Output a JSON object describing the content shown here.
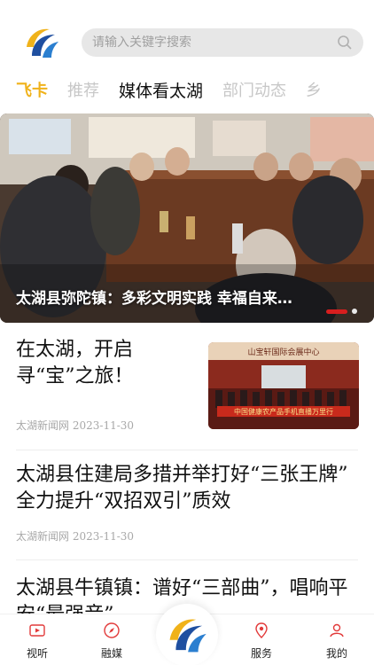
{
  "search": {
    "placeholder": "请输入关键字搜索"
  },
  "tabs": [
    {
      "label": "飞卡"
    },
    {
      "label": "推荐"
    },
    {
      "label": "媒体看太湖"
    },
    {
      "label": "部门动态"
    },
    {
      "label": "乡"
    }
  ],
  "banner": {
    "caption": "太湖县弥陀镇：多彩文明实践 幸福自来…"
  },
  "thumb": {
    "sign": "中国健康农产品手机直播万里行",
    "header": "山宝轩国际会展中心"
  },
  "news": [
    {
      "title": "在太湖，开启寻“宝”之旅！",
      "source": "太湖新闻网",
      "date": "2023-11-30"
    },
    {
      "title": "太湖县住建局多措并举打好“三张王牌” 全力提升“双招双引”质效",
      "source": "太湖新闻网",
      "date": "2023-11-30"
    },
    {
      "title": "太湖县牛镇镇：谱好“三部曲”，唱响平安“最强音”"
    }
  ],
  "nav": [
    {
      "label": "视听",
      "icon": "video-icon"
    },
    {
      "label": "融媒",
      "icon": "compass-icon"
    },
    {
      "label": "",
      "icon": "app-logo-icon"
    },
    {
      "label": "服务",
      "icon": "location-icon"
    },
    {
      "label": "我的",
      "icon": "user-icon"
    }
  ],
  "colors": {
    "brand": "#f0b21a",
    "accent": "#d81e1e",
    "logo_blue": "#1f4fa0"
  }
}
